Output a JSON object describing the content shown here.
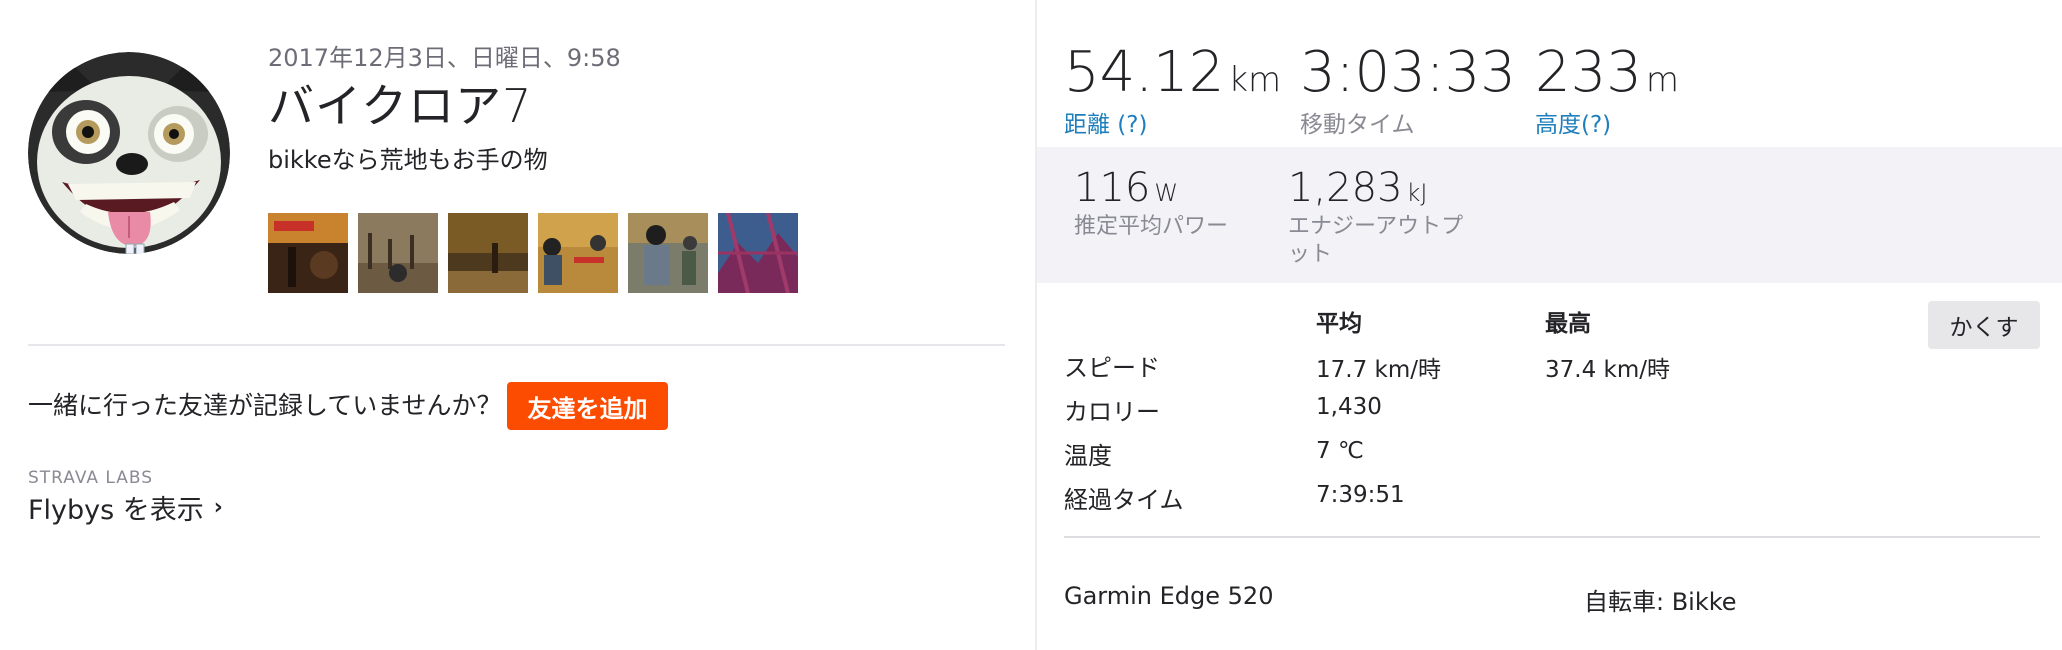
{
  "activity": {
    "date": "2017年12月3日、日曜日、9:58",
    "title": "バイクロア7",
    "description": "bikkeなら荒地もお手の物",
    "photos_count": 6
  },
  "friends": {
    "question": "一緒に行った友達が記録していませんか？",
    "add_button": "友達を追加"
  },
  "labs": {
    "label": "STRAVA LABS",
    "flybys": "Flybys を表示"
  },
  "stats": {
    "distance": {
      "value": "54.12",
      "unit": "km",
      "label": "距離 (?)"
    },
    "moving_time": {
      "value": "3:03:33",
      "label": "移動タイム"
    },
    "elevation": {
      "value": "233",
      "unit": "m",
      "label": "高度(?)"
    }
  },
  "secondary": {
    "power": {
      "value": "116",
      "unit": "W",
      "label": "推定平均パワー"
    },
    "energy": {
      "value": "1,283",
      "unit": "kJ",
      "label_line1": "エナジーアウトプ",
      "label_line2": "ット"
    }
  },
  "table": {
    "col_avg": "平均",
    "col_max": "最高",
    "hide_button": "かくす",
    "rows": [
      {
        "label": "スピード",
        "avg": "17.7 km/時",
        "max": "37.4 km/時"
      },
      {
        "label": "カロリー",
        "avg": "1,430"
      },
      {
        "label": "温度",
        "avg": "7 ℃"
      },
      {
        "label": "経過タイム",
        "avg": "7:39:51"
      }
    ]
  },
  "footer": {
    "device": "Garmin Edge 520",
    "bike": "自転車: Bikke"
  },
  "colors": {
    "accent": "#fc4c02",
    "link": "#1f7fbc",
    "panel": "#f2f2f7"
  }
}
